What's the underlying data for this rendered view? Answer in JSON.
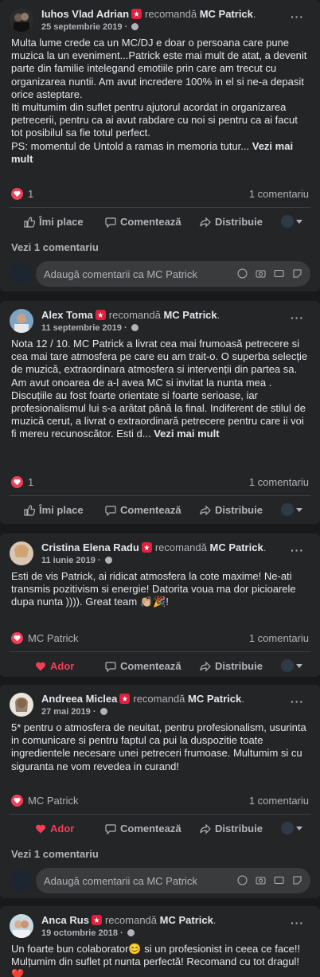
{
  "actions": {
    "like": "Îmi place",
    "love": "Ador",
    "comment": "Comentează",
    "share": "Distribuie"
  },
  "comment_placeholder": "Adaugă comentarii ca MC Patrick",
  "recommends_word": "recomandă",
  "page_name": "MC Patrick",
  "posts": [
    {
      "author": "Iuhos Vlad Adrian",
      "date": "25 septembrie 2019 · ",
      "text": "Multa lume crede ca un MC/DJ e doar o persoana care pune muzica la un eveniment...Patrick este mai mult de atat, a devenit parte din familie intelegand emotiile prin care am trecut cu organizarea nuntii. Am avut incredere 100% in el si ne-a depasit orice asteptare.\nIti multumim din suflet pentru ajutorul acordat in organizarea petrecerii, pentru ca ai avut rabdare cu noi si pentru ca ai facut tot posibilul sa fie totul perfect.\nPS: momentul de Untold a ramas in memoria tutur... ",
      "see_more": "Vezi mai mult",
      "reactions": "1",
      "comments": "1 comentariu",
      "view_comments": "Vezi 1 comentariu"
    },
    {
      "author": "Alex Toma",
      "date": "11 septembrie 2019 · ",
      "text": "Nota 12 / 10. MC Patrick a livrat cea mai frumoasă petrecere si cea mai tare atmosfera pe care eu am trait-o. O superba selecție de muzică, extraordinara atmosfera si intervenții din partea sa. Am avut onoarea de a-l avea MC si invitat la nunta mea . Discuțiile au fost foarte orientate si foarte serioase, iar profesionalismul lui s-a arătat până la final. Indiferent de stilul de muzică cerut, a livrat o extraordinară petrecere pentru care ii voi fi mereu recunoscător. Esti d... ",
      "see_more": "Vezi mai mult",
      "reactions": "1",
      "comments": "1 comentariu"
    },
    {
      "author": "Cristina Elena Radu",
      "date": "11 iunie 2019 · ",
      "text": "Esti de vis Patrick, ai ridicat atmosfera la cote maxime! Ne-ati transmis pozitivism si energie! Datorita voua ma dor picioarele dupa nunta )))).  Great team 👏🏼🎉!",
      "reactions": "MC Patrick",
      "comments": "1 comentariu"
    },
    {
      "author": "Andreea Miclea",
      "date": "27 mai 2019 · ",
      "text": "5* pentru o atmosfera de neuitat, pentru profesionalism, usurinta in comunicare si pentru faptul ca pui la duspozitie toate ingredientele necesare unei petreceri frumoase. Multumim si cu siguranta ne vom revedea in curand!",
      "reactions": "MC Patrick",
      "comments": "1 comentariu",
      "view_comments": "Vezi 1 comentariu"
    },
    {
      "author": "Anca Rus",
      "date": "19 octombrie 2018 · ",
      "text": "Un foarte bun colaborator😊 si un profesionist in ceea ce face!! Mulțumim din suflet pt nunta perfectă! Recomand cu tot dragul!❤️"
    }
  ]
}
